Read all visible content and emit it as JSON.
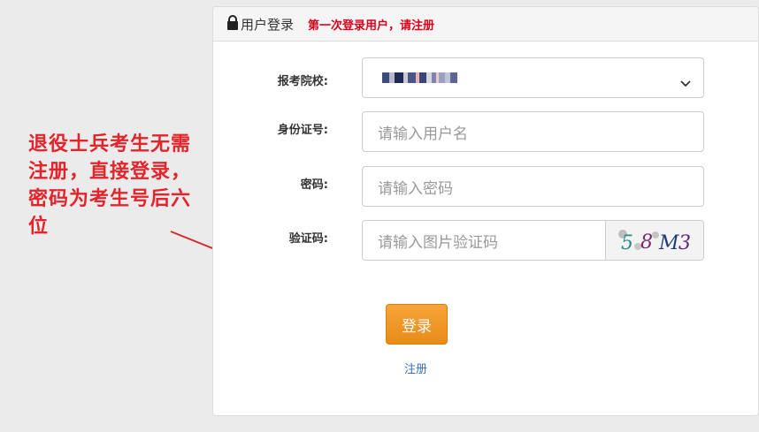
{
  "annotation": {
    "text": "退役士兵考生无需注册，直接登录，密码为考生号后六位",
    "color": "#e3242b"
  },
  "panel": {
    "header": {
      "icon": "lock-icon",
      "title": "用户登录",
      "note": "第一次登录用户，请注册"
    },
    "fields": {
      "school": {
        "label": "报考院校:",
        "value_obscured": true
      },
      "id_number": {
        "label": "身份证号:",
        "placeholder": "请输入用户名"
      },
      "password": {
        "label": "密码:",
        "placeholder": "请输入密码"
      },
      "captcha": {
        "label": "验证码:",
        "placeholder": "请输入图片验证码",
        "image_text": "58M3"
      }
    },
    "login_label": "登录",
    "register_label": "注册",
    "accent_color": "#f0982a",
    "link_color": "#3a6fb3",
    "note_color": "#d9001b"
  }
}
